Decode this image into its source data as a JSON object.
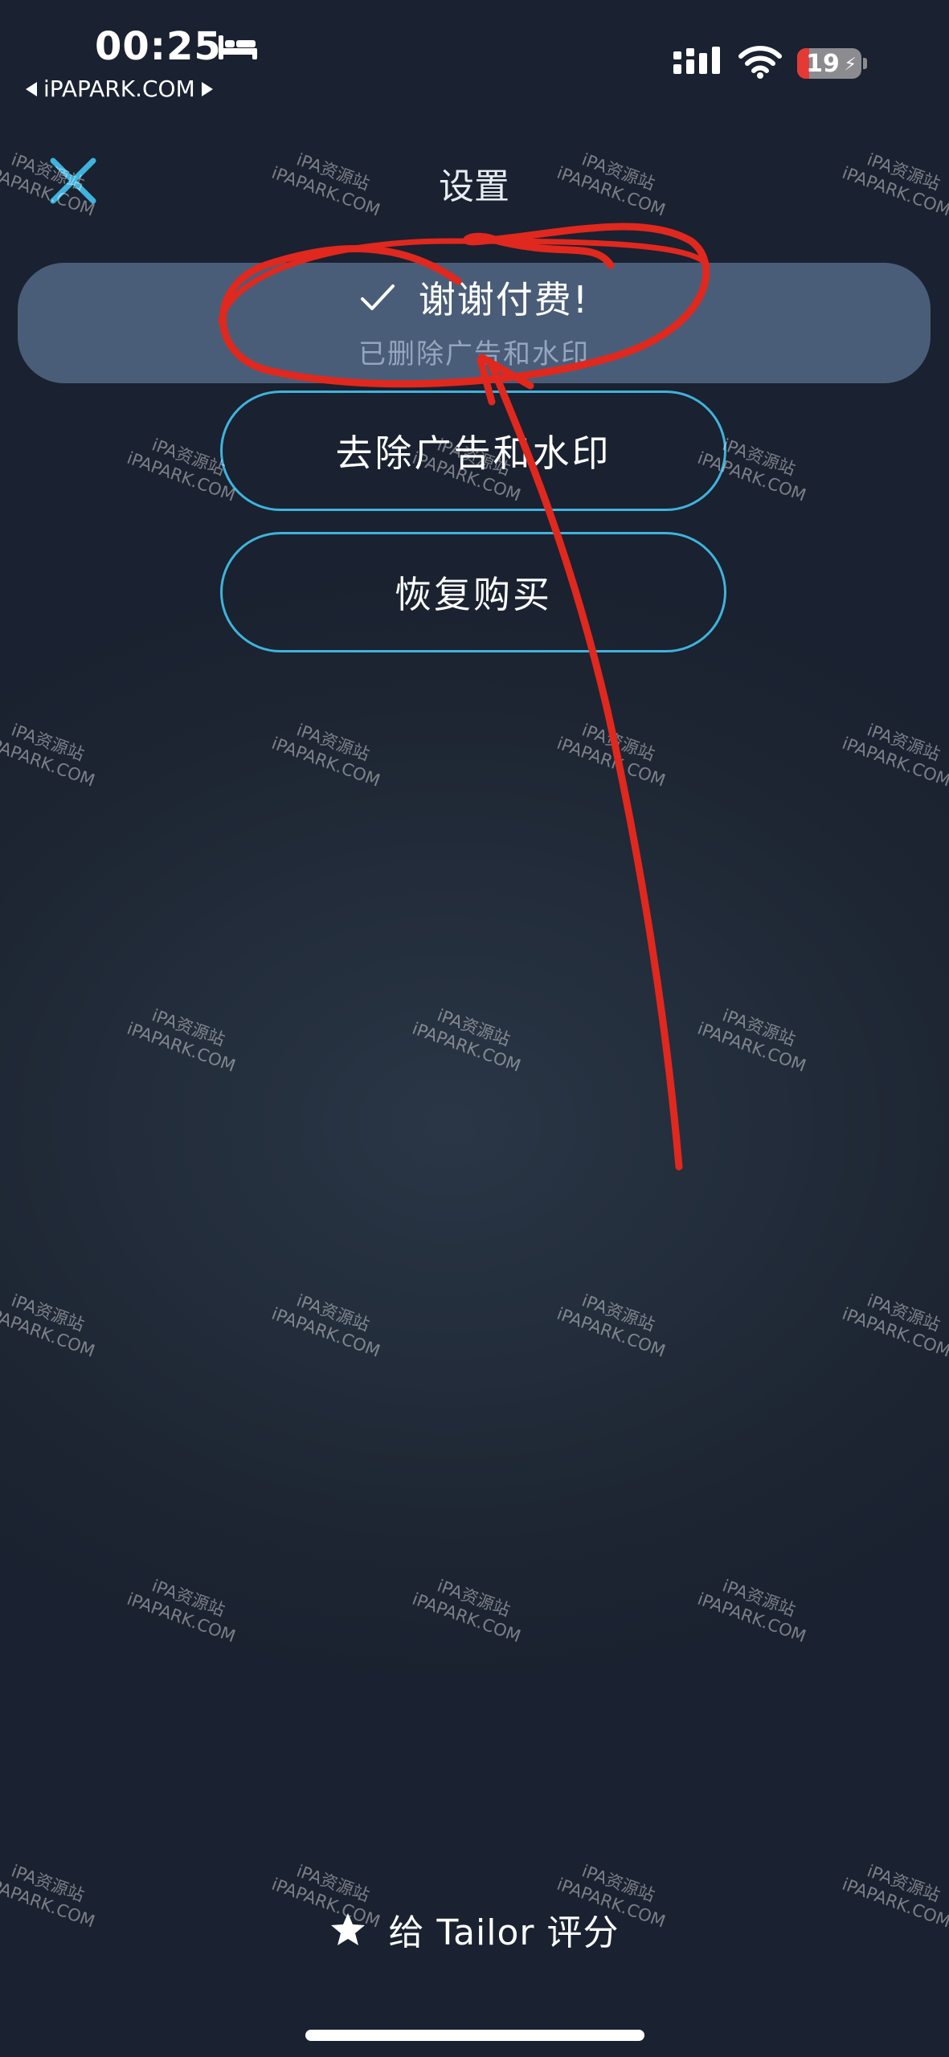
{
  "status_bar": {
    "time": "00:25",
    "back_app": "iPAPARK.COM",
    "battery_percent": "19",
    "battery_level": 0.19
  },
  "nav": {
    "title": "设置"
  },
  "thanks": {
    "title": "谢谢付费!",
    "subtitle": "已删除广告和水印"
  },
  "buttons": {
    "remove_ads": "去除广告和水印",
    "restore": "恢复购买"
  },
  "footer": {
    "rate_label": "给 Tailor 评分"
  },
  "watermark": {
    "line1": "iPA资源站",
    "line2": "iPAPARK.COM"
  },
  "colors": {
    "accent": "#3fb3dc",
    "banner": "#4a5d78",
    "annotation_red": "#e0281e"
  }
}
